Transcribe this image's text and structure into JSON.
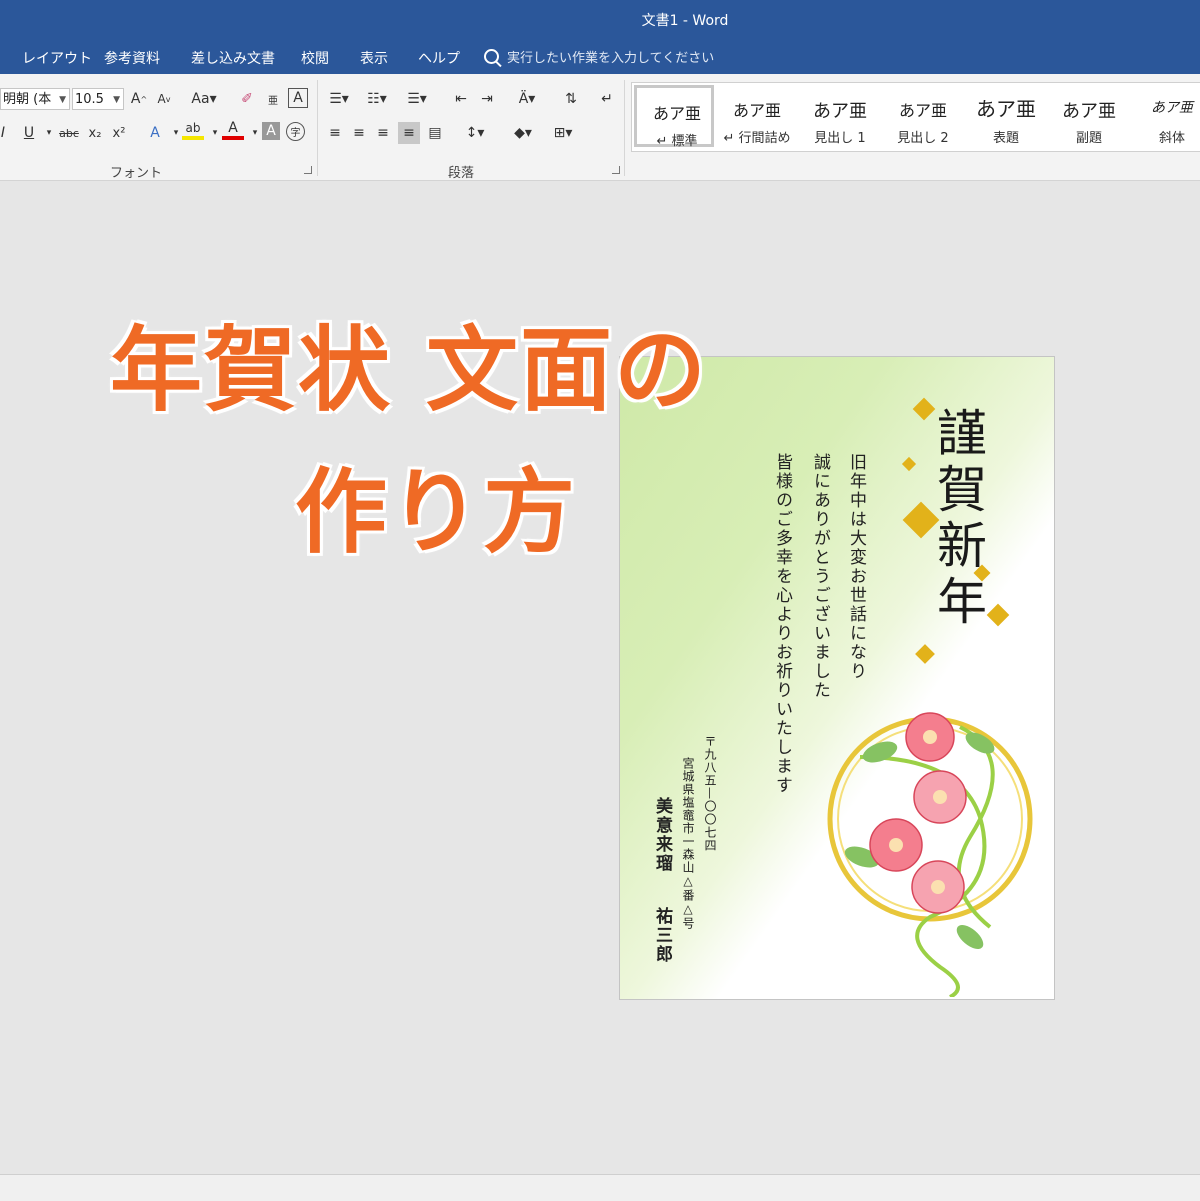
{
  "window": {
    "title": "文書1  -  Word"
  },
  "menu": {
    "tabs": [
      "レイアウト",
      "参考資料",
      "差し込み文書",
      "校閲",
      "表示",
      "ヘルプ"
    ],
    "tell_me": "実行したい作業を入力してください"
  },
  "ribbon": {
    "font_name": "明朝 (本",
    "font_size": "10.5",
    "font_group_label": "フォント",
    "paragraph_group_label": "段落",
    "styles": [
      {
        "sample": "あア亜",
        "name": "↵ 標準"
      },
      {
        "sample": "あア亜",
        "name": "↵ 行間詰め"
      },
      {
        "sample": "あア亜",
        "name": "見出し 1"
      },
      {
        "sample": "あア亜",
        "name": "見出し 2"
      },
      {
        "sample": "あア亜",
        "name": "表題"
      },
      {
        "sample": "あア亜",
        "name": "副題"
      },
      {
        "sample": "あア亜",
        "name": "斜体"
      }
    ],
    "underline_label": "U",
    "bold_italic_label": "I",
    "strike_label": "abc",
    "sub_label": "x₂",
    "sup_label": "x²"
  },
  "colors": {
    "title_bar": "#2b579a",
    "overlay_text": "#ef6a25",
    "font_color_bar": "#e00000",
    "highlight_bar": "#f5e600"
  },
  "overlay": {
    "line1": "年賀状 文面の",
    "line2": "作り方"
  },
  "card": {
    "greeting": "謹賀新年",
    "lines": [
      "旧年中は大変お世話になり",
      "誠にありがとうございました",
      "皆様のご多幸を心よりお祈りいたします"
    ],
    "postal": "〒九八五—〇〇七四",
    "address": "宮城県塩竈市一森山△番△号",
    "names": [
      "美意来瑠",
      "祐三郎"
    ]
  }
}
